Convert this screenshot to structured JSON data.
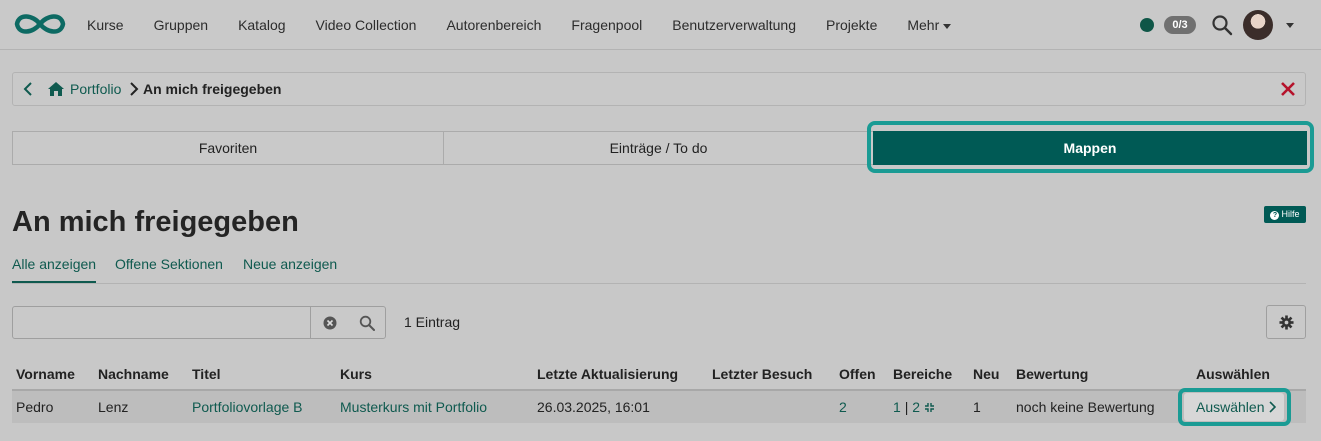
{
  "nav": {
    "items": [
      "Kurse",
      "Gruppen",
      "Katalog",
      "Video Collection",
      "Autorenbereich",
      "Fragenpool",
      "Benutzerverwaltung",
      "Projekte"
    ],
    "more_label": "Mehr",
    "badge": "0/3"
  },
  "breadcrumb": {
    "root": "Portfolio",
    "current": "An mich freigegeben"
  },
  "segment_tabs": [
    "Favoriten",
    "Einträge / To do",
    "Mappen"
  ],
  "page": {
    "title": "An mich freigegeben",
    "help_label": "Hilfe"
  },
  "filter_tabs": [
    "Alle anzeigen",
    "Offene Sektionen",
    "Neue anzeigen"
  ],
  "search": {
    "value": "",
    "placeholder": ""
  },
  "result_count": "1 Eintrag",
  "table": {
    "headers": [
      "Vorname",
      "Nachname",
      "Titel",
      "Kurs",
      "Letzte Aktualisierung",
      "Letzter Besuch",
      "Offen",
      "Bereiche",
      "Neu",
      "Bewertung",
      "Auswählen"
    ],
    "rows": [
      {
        "vorname": "Pedro",
        "nachname": "Lenz",
        "titel": "Portfoliovorlage B",
        "kurs": "Musterkurs mit Portfolio",
        "letzte_aktualisierung": "26.03.2025, 16:01",
        "letzter_besuch": "",
        "offen": "2",
        "bereiche_1": "1",
        "bereiche_sep": "|",
        "bereiche_2": "2",
        "neu": "1",
        "bewertung": "noch keine Bewertung",
        "auswaehlen": "Auswählen"
      }
    ]
  },
  "colors": {
    "brand": "#005a55",
    "highlight": "#1a9b94",
    "link": "#0f5a4f",
    "close": "#b5122b"
  },
  "icons": [
    "openolat-logo-icon",
    "status-dot-icon",
    "search-icon",
    "chevron-down-icon",
    "chevron-left-icon",
    "home-icon",
    "chevron-right-icon",
    "close-icon",
    "help-icon",
    "clear-icon",
    "gear-icon",
    "compress-icon"
  ]
}
